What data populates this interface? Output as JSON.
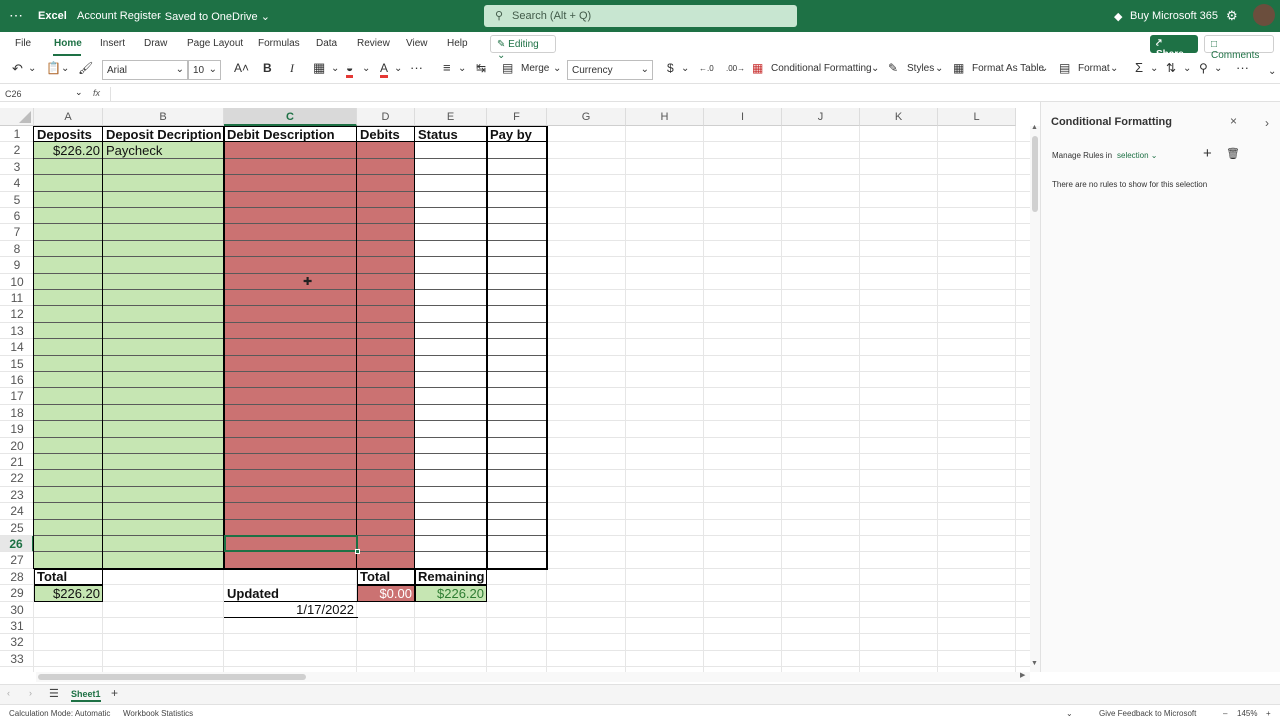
{
  "titlebar": {
    "app_name": "Excel",
    "doc_title": "Account Register",
    "save_status": "Saved to OneDrive",
    "search_placeholder": "Search (Alt + Q)",
    "buy_label": "Buy Microsoft 365"
  },
  "ribbon": {
    "tabs": [
      "File",
      "Home",
      "Insert",
      "Draw",
      "Page Layout",
      "Formulas",
      "Data",
      "Review",
      "View",
      "Help"
    ],
    "active_tab": "Home",
    "editing_label": "Editing",
    "share_label": "Share",
    "comments_label": "Comments"
  },
  "toolbar": {
    "font_name": "Arial",
    "font_size": "10",
    "merge_label": "Merge",
    "number_format": "Currency",
    "currency_symbol": "$",
    "conditional_formatting_label": "Conditional Formatting",
    "styles_label": "Styles",
    "format_as_table_label": "Format As Table",
    "format_label": "Format"
  },
  "formula_bar": {
    "name_box": "C26",
    "fx": "fx"
  },
  "grid": {
    "columns": [
      "A",
      "B",
      "C",
      "D",
      "E",
      "F",
      "G",
      "H",
      "I",
      "J",
      "K",
      "L"
    ],
    "selected_column": "C",
    "rows": [
      "1",
      "2",
      "3",
      "4",
      "5",
      "6",
      "7",
      "8",
      "9",
      "10",
      "11",
      "12",
      "13",
      "14",
      "15",
      "16",
      "17",
      "18",
      "19",
      "20",
      "21",
      "22",
      "23",
      "24",
      "25",
      "26",
      "27",
      "28",
      "29",
      "30",
      "31",
      "32",
      "33"
    ],
    "selected_row": "26",
    "headers": {
      "deposits": "Deposits",
      "deposit_description": "Deposit Decription",
      "debit_description": "Debit Description",
      "debits": "Debits",
      "status": "Status",
      "pay_by": "Pay by"
    },
    "row2": {
      "deposit": "$226.20",
      "description": "Paycheck"
    },
    "totals": {
      "total_label_a": "Total",
      "total_deposits": "$226.20",
      "updated_label": "Updated",
      "updated_date": "1/17/2022",
      "total_label_d": "Total",
      "total_debits": "$0.00",
      "remaining_label": "Remaining",
      "remaining_value": "$226.20"
    },
    "colors": {
      "green_fill": "#c6e6b3",
      "red_fill": "#cb7272",
      "remaining_fill": "#c6e6b3",
      "remaining_text": "#2e7d32"
    }
  },
  "panel": {
    "title": "Conditional Formatting",
    "manage_rules_label": "Manage Rules in",
    "scope": "selection",
    "empty_message": "There are no rules to show for this selection"
  },
  "sheets": {
    "tabs": [
      "Sheet1"
    ]
  },
  "status": {
    "calc_mode": "Calculation Mode: Automatic",
    "workbook_stats": "Workbook Statistics",
    "feedback": "Give Feedback to Microsoft",
    "zoom": "145%"
  }
}
